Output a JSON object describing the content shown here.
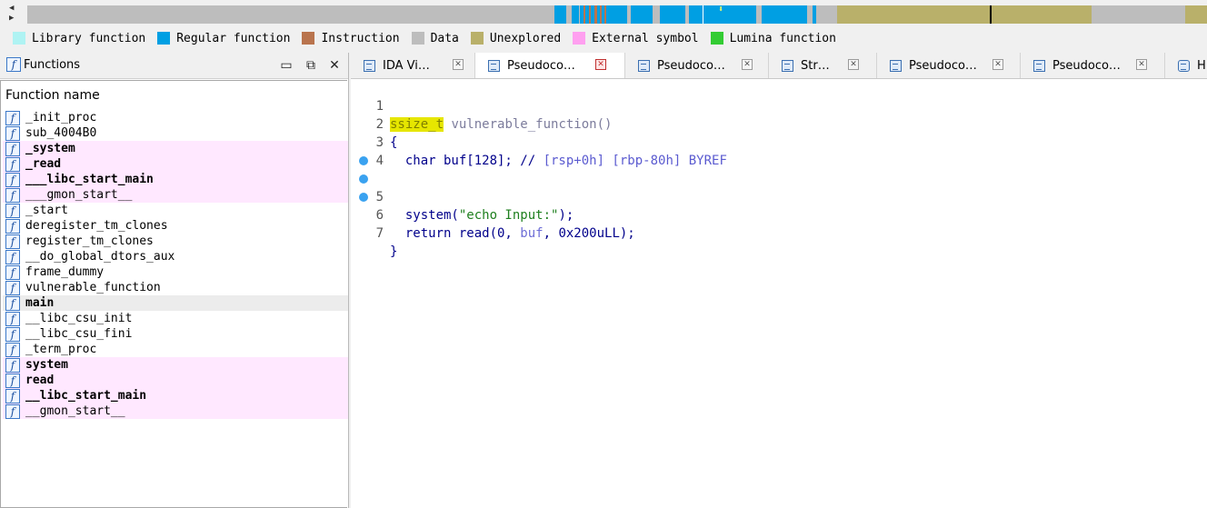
{
  "navband": {
    "arrow_up": "◀",
    "arrow_down": "▶"
  },
  "legend": [
    {
      "label": "Library function",
      "color": "#aff3f3"
    },
    {
      "label": "Regular function",
      "color": "#009fe3"
    },
    {
      "label": "Instruction",
      "color": "#b9744e"
    },
    {
      "label": "Data",
      "color": "#bdbdbd"
    },
    {
      "label": "Unexplored",
      "color": "#b9b06a"
    },
    {
      "label": "External symbol",
      "color": "#ffa0f0"
    },
    {
      "label": "Lumina function",
      "color": "#33cc33"
    }
  ],
  "functions_panel": {
    "title": "Functions",
    "column_header": "Function name",
    "icon_glyph": "f",
    "restore_glyph": "▣",
    "undock_glyph": "⧉",
    "close_glyph": "✕",
    "items": [
      {
        "name": "_init_proc",
        "bold": false,
        "external": false
      },
      {
        "name": "sub_4004B0",
        "bold": false,
        "external": false
      },
      {
        "name": "_system",
        "bold": true,
        "external": true
      },
      {
        "name": "_read",
        "bold": true,
        "external": true
      },
      {
        "name": "___libc_start_main",
        "bold": true,
        "external": true
      },
      {
        "name": "___gmon_start__",
        "bold": false,
        "external": true
      },
      {
        "name": "_start",
        "bold": false,
        "external": false
      },
      {
        "name": "deregister_tm_clones",
        "bold": false,
        "external": false
      },
      {
        "name": "register_tm_clones",
        "bold": false,
        "external": false
      },
      {
        "name": "__do_global_dtors_aux",
        "bold": false,
        "external": false
      },
      {
        "name": "frame_dummy",
        "bold": false,
        "external": false
      },
      {
        "name": "vulnerable_function",
        "bold": false,
        "external": false
      },
      {
        "name": "main",
        "bold": true,
        "external": false,
        "selected": true
      },
      {
        "name": "__libc_csu_init",
        "bold": false,
        "external": false
      },
      {
        "name": "__libc_csu_fini",
        "bold": false,
        "external": false
      },
      {
        "name": "_term_proc",
        "bold": false,
        "external": false
      },
      {
        "name": "system",
        "bold": true,
        "external": true
      },
      {
        "name": "read",
        "bold": true,
        "external": true
      },
      {
        "name": "__libc_start_main",
        "bold": true,
        "external": true
      },
      {
        "name": "__gmon_start__",
        "bold": false,
        "external": true
      }
    ]
  },
  "tabs": [
    {
      "label": "IDA Vi…",
      "active": false
    },
    {
      "label": "Pseudoco…",
      "active": true
    },
    {
      "label": "Pseudoco…",
      "active": false
    },
    {
      "label": "Str…",
      "active": false
    },
    {
      "label": "Pseudoco…",
      "active": false
    },
    {
      "label": "Pseudoco…",
      "active": false
    },
    {
      "label": "H",
      "active": false
    }
  ],
  "tab_close_glyph": "✕",
  "code": {
    "line_numbers": [
      "1",
      "2",
      "3",
      "4",
      "5",
      "6",
      "7"
    ],
    "breakpoint_lines": [
      5,
      6,
      7
    ],
    "l1_type": "ssize_t",
    "l1_rest": " vulnerable_function()",
    "l2": "{",
    "l3_decl": "  char buf[128]; // ",
    "l3_comment": "[rsp+0h] [rbp-80h] BYREF",
    "l4": "",
    "l5_fn": "  system(",
    "l5_str": "\"echo Input:\"",
    "l5_end": ");",
    "l6_pre": "  return read(0, ",
    "l6_var": "buf",
    "l6_post": ", 0x200uLL);",
    "l7": "}"
  }
}
